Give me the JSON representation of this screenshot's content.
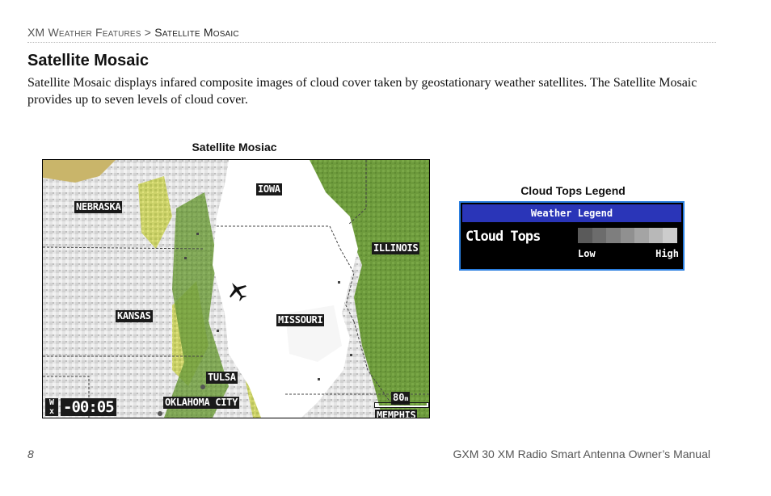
{
  "breadcrumb": {
    "section": "XM Weather Features",
    "separator": ">",
    "current": "Satellite Mosaic"
  },
  "title": "Satellite Mosaic",
  "body": "Satellite Mosaic displays infared composite images of cloud cover taken by geostationary weather satellites. The Satellite Mosaic provides up to seven levels of cloud cover.",
  "map_figure": {
    "caption": "Satellite Mosiac",
    "labels": {
      "iowa": "IOWA",
      "nebraska": "NEBRASKA",
      "illinois": "ILLINOIS",
      "kansas": "KANSAS",
      "missouri": "MISSOURI",
      "tulsa": "TULSA",
      "oklahoma_city": "OKLAHOMA CITY",
      "memphis": "MEMPHIS"
    },
    "time_readout": "-00:05",
    "wx_icon_text": "W x",
    "scale_value": "80",
    "scale_unit": "m",
    "icons": [
      "aircraft-position-icon",
      "weather-data-icon",
      "map-scale-bar"
    ]
  },
  "legend_figure": {
    "caption": "Cloud Tops Legend",
    "header": "Weather Legend",
    "name": "Cloud Tops",
    "low_label": "Low",
    "high_label": "High",
    "swatch_colors": [
      "#5a5a5a",
      "#6c6c6c",
      "#7e7e7e",
      "#909090",
      "#a4a4a4",
      "#b8b8b8",
      "#cccccc"
    ]
  },
  "colors": {
    "legend_header_bg": "#2a35b8",
    "legend_border": "#2b7fe0",
    "vegetation_green": "#6f9a3a",
    "cloud_white": "#ffffff"
  },
  "footer": {
    "page_number": "8",
    "manual_title": "GXM 30 XM Radio Smart Antenna Owner’s Manual"
  }
}
